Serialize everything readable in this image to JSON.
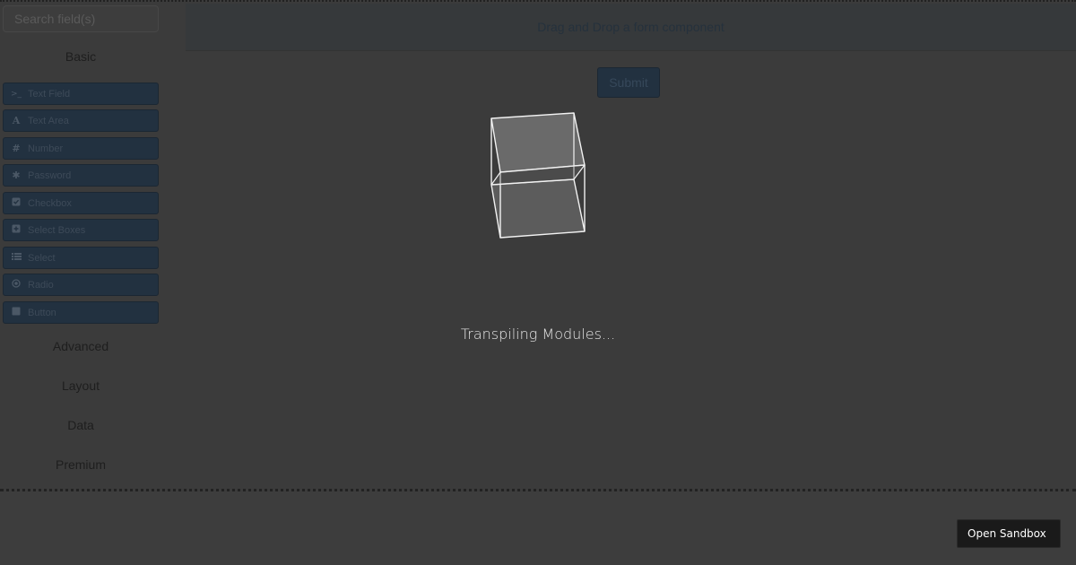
{
  "sidebar": {
    "search_placeholder": "Search field(s)",
    "basic_title": "Basic",
    "components": [
      {
        "label": "Text Field",
        "icon": "terminal-icon"
      },
      {
        "label": "Text Area",
        "icon": "font-icon"
      },
      {
        "label": "Number",
        "icon": "hashtag-icon"
      },
      {
        "label": "Password",
        "icon": "asterisk-icon"
      },
      {
        "label": "Checkbox",
        "icon": "check-square-icon"
      },
      {
        "label": "Select Boxes",
        "icon": "plus-square-icon"
      },
      {
        "label": "Select",
        "icon": "list-icon"
      },
      {
        "label": "Radio",
        "icon": "dot-circle-icon"
      },
      {
        "label": "Button",
        "icon": "stop-icon"
      }
    ],
    "groups": [
      "Advanced",
      "Layout",
      "Data",
      "Premium"
    ]
  },
  "builder": {
    "dropzone_text": "Drag and Drop a form component",
    "submit_label": "Submit"
  },
  "overlay": {
    "loading_text": "Transpiling Modules..."
  },
  "footer": {
    "open_sandbox_label": "Open Sandbox"
  }
}
